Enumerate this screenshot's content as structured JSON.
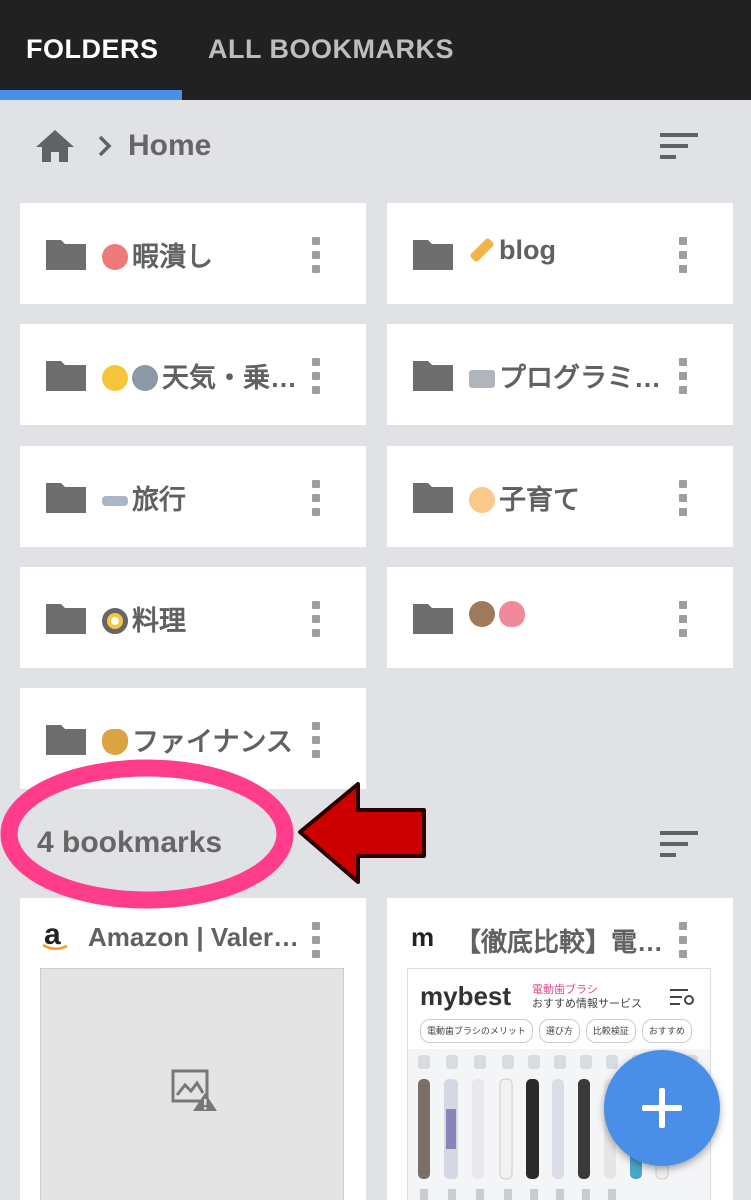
{
  "tabs": [
    {
      "label": "FOLDERS",
      "active": true
    },
    {
      "label": "ALL BOOKMARKS",
      "active": false
    }
  ],
  "breadcrumb": {
    "icon": "home-icon",
    "separator_icon": "chevron-right-icon",
    "label": "Home"
  },
  "folders": [
    {
      "label": "暇潰し",
      "emoji": "clown-face-icon"
    },
    {
      "label": "blog",
      "emoji": "pencil-icon"
    },
    {
      "label": "天気・乗…",
      "emoji": "sun-icon, train-icon"
    },
    {
      "label": "プログラミ…",
      "emoji": "laptop-icon"
    },
    {
      "label": "旅行",
      "emoji": "airplane-icon"
    },
    {
      "label": "子育て",
      "emoji": "baby-icon"
    },
    {
      "label": "料理",
      "emoji": "frying-pan-icon"
    },
    {
      "label": "",
      "emoji": "bearded-man-icon, heart-icon"
    },
    {
      "label": "ファイナンス",
      "emoji": "money-bag-icon"
    }
  ],
  "bookmarks_section": {
    "title": "4 bookmarks"
  },
  "bookmarks": [
    {
      "favicon": "a",
      "title": "Amazon | Valery…",
      "thumbnail": "broken-image-icon"
    },
    {
      "favicon": "m",
      "title": "【徹底比較】電…",
      "thumbnail": "page-preview"
    }
  ],
  "preview": {
    "logo": "mybest",
    "tag": "電動歯ブラシ",
    "sub": "おすすめ情報サービス",
    "chips": [
      "電動歯ブラシのメリット",
      "選び方",
      "比較検証",
      "おすすめ"
    ]
  },
  "colors": {
    "accent": "#4a8fe7",
    "annotation_pink": "#ff3d8b",
    "annotation_red": "#d40000"
  }
}
